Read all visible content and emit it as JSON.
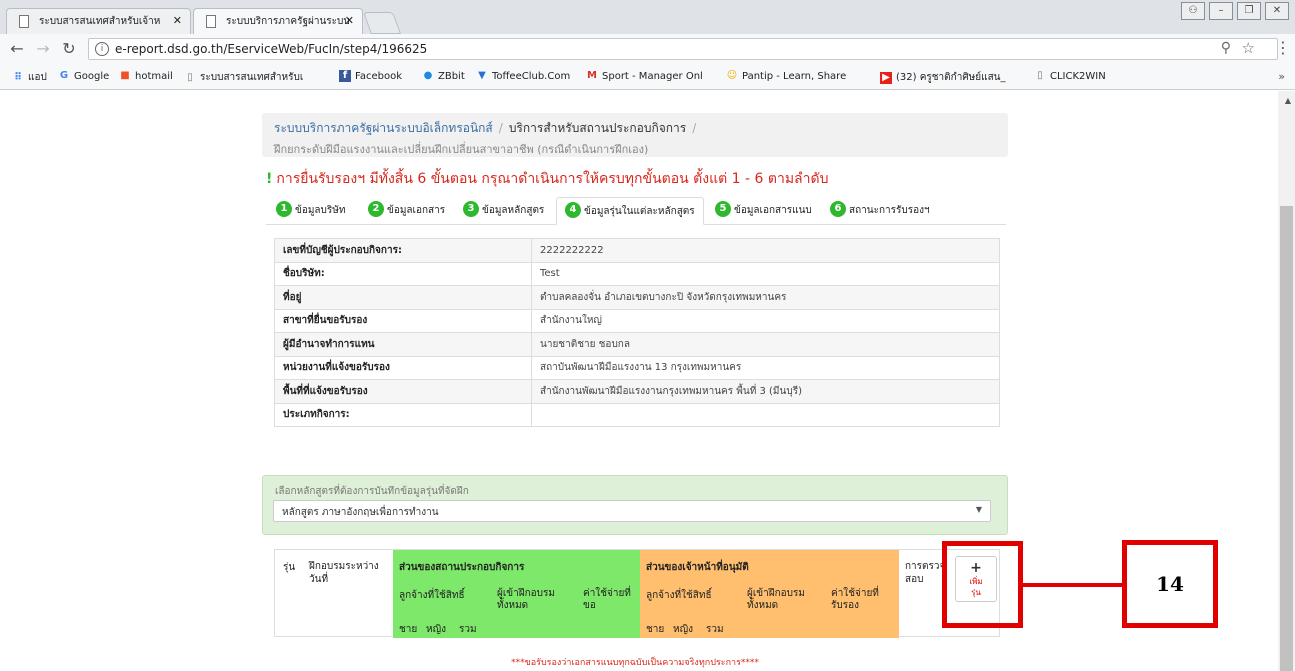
{
  "browser": {
    "tabs": [
      {
        "title": "ระบบสารสนเทศสำหรับเจ้าห",
        "active": false
      },
      {
        "title": "ระบบบริการภาครัฐผ่านระบบ",
        "active": true
      }
    ],
    "url": "e-report.dsd.go.th/EserviceWeb/FucIn/step4/196625",
    "bookmarks": [
      {
        "label": "แอป",
        "icon": "apps-grid-icon"
      },
      {
        "label": "Google",
        "icon": "google-icon"
      },
      {
        "label": "hotmail",
        "icon": "windows-icon"
      },
      {
        "label": "ระบบสารสนเทศสำหรับเ",
        "icon": "page-icon"
      },
      {
        "label": "Facebook",
        "icon": "facebook-icon"
      },
      {
        "label": "ZBbit",
        "icon": "zbbit-icon"
      },
      {
        "label": "ToffeeClub.Com",
        "icon": "toffee-icon"
      },
      {
        "label": "Sport - Manager Onl",
        "icon": "gmail-icon"
      },
      {
        "label": "Pantip - Learn, Share",
        "icon": "pantip-icon"
      },
      {
        "label": "(32) ครูชาติกำศิษย์แสน_",
        "icon": "youtube-icon"
      },
      {
        "label": "CLICK2WIN",
        "icon": "page-icon"
      }
    ],
    "bookmarks_more": "»"
  },
  "breadcrumb": {
    "root": "ระบบบริการภาครัฐผ่านระบบอิเล็กทรอนิกส์",
    "section": "บริการสำหรับสถานประกอบกิจการ",
    "subtitle": "ฝึกยกระดับฝีมือแรงงานและเปลี่ยนฝึกเปลี่ยนสาขาอาชีพ (กรณีดำเนินการฝึกเอง)"
  },
  "notice": "การยื่นรับรองฯ มีทั้งสิ้น 6 ขั้นตอน กรุณาดำเนินการให้ครบทุกขั้นตอน ตั้งแต่ 1 - 6 ตามลำดับ",
  "steps": [
    {
      "num": "1",
      "label": "ข้อมูลบริษัท"
    },
    {
      "num": "2",
      "label": "ข้อมูลเอกสาร"
    },
    {
      "num": "3",
      "label": "ข้อมูลหลักสูตร"
    },
    {
      "num": "4",
      "label": "ข้อมูลรุ่นในแต่ละหลักสูตร"
    },
    {
      "num": "5",
      "label": "ข้อมูลเอกสารแนบ"
    },
    {
      "num": "6",
      "label": "สถานะการรับรองฯ"
    }
  ],
  "info_rows": [
    {
      "key": "เลขที่บัญชีผู้ประกอบกิจการ:",
      "value": "2222222222"
    },
    {
      "key": "ชื่อบริษัท:",
      "value": "Test"
    },
    {
      "key": "ที่อยู่",
      "value": "ตำบลคลองจั่น อำเภอเขตบางกะปิ จังหวัดกรุงเทพมหานคร"
    },
    {
      "key": "สาขาที่ยื่นขอรับรอง",
      "value": "สำนักงานใหญ่"
    },
    {
      "key": "ผู้มีอำนาจทำการแทน",
      "value": "นายชาติชาย ชอบกล"
    },
    {
      "key": "หน่วยงานที่แจ้งขอรับรอง",
      "value": "สถาบันพัฒนาฝีมือแรงงาน 13 กรุงเทพมหานคร"
    },
    {
      "key": "พื้นที่ที่แจ้งขอรับรอง",
      "value": "สำนักงานพัฒนาฝีมือแรงงานกรุงเทพมหานคร พื้นที่ 3 (มีนบุรี)"
    },
    {
      "key": "ประเภทกิจการ:",
      "value": ""
    }
  ],
  "course": {
    "label": "เลือกหลักสูตรที่ต้องการบันทึกข้อมูลรุ่นที่จัดฝึก",
    "selected": "หลักสูตร ภาษาอังกฤษเพื่อการทำงาน"
  },
  "grid": {
    "col_cohort": "รุ่น",
    "col_period": "ฝึกอบรมระหว่างวันที่",
    "group_company": "ส่วนของสถานประกอบกิจการ",
    "group_officer": "ส่วนของเจ้าหน้าที่อนุมัติ",
    "col_employees": "ลูกจ้างที่ใช้สิทธิ์",
    "col_trainees": "ผู้เข้าฝึกอบรมทั้งหมด",
    "col_expense_req": "ค่าใช้จ่ายที่ขอ",
    "col_expense_cert": "ค่าใช้จ่ายที่รับรอง",
    "col_inspect": "การตรวจสอบ",
    "male": "ชาย",
    "female": "หญิง",
    "total": "รวม",
    "add_plus": "+",
    "add_label_1": "เพิ่ม",
    "add_label_2": "รุ่น"
  },
  "callout": "14",
  "footer": "***ขอรับรองว่าเอกสารแนบทุกฉบับเป็นความจริงทุกประการ****",
  "colors": {
    "accent_red": "#e00000",
    "step_green": "#2eb82e",
    "company_green": "#7ee86a",
    "officer_orange": "#ffbf6e"
  }
}
